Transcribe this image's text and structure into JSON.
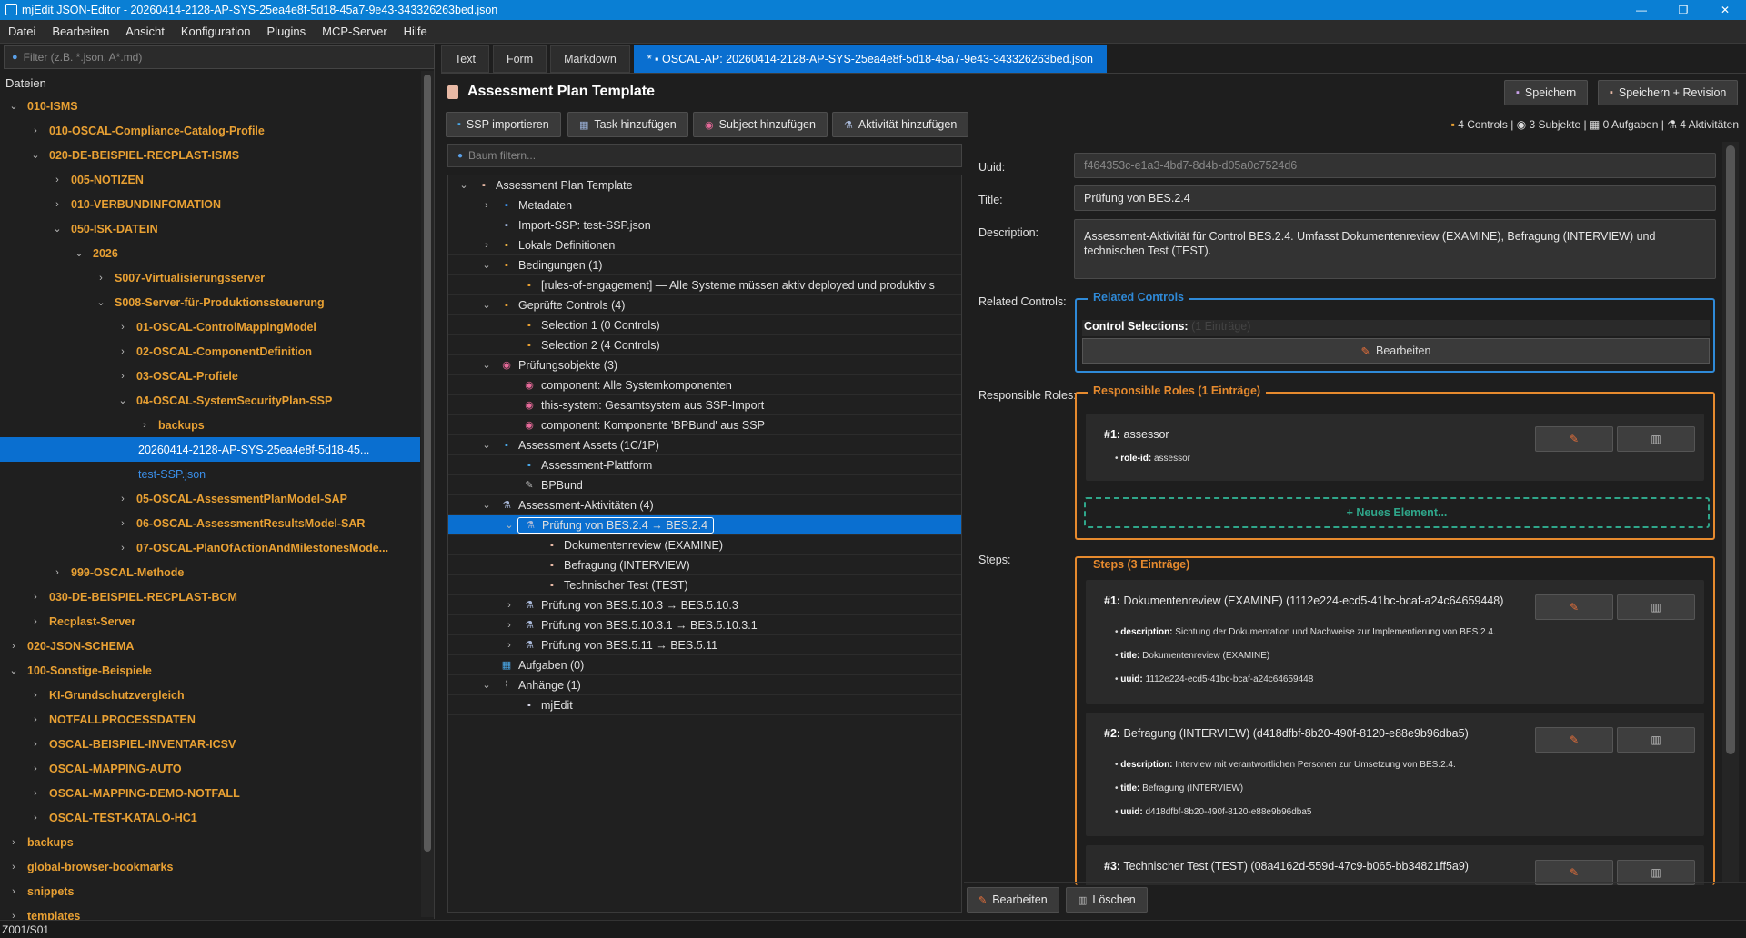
{
  "window": {
    "title": "mjEdit JSON-Editor - 20260414-2128-AP-SYS-25ea4e8f-5d18-45a7-9e43-343326263bed.json",
    "minimize": "—",
    "maximize": "❐",
    "close": "✕"
  },
  "menu": [
    "Datei",
    "Bearbeiten",
    "Ansicht",
    "Konfiguration",
    "Plugins",
    "MCP-Server",
    "Hilfe"
  ],
  "sidebar": {
    "filter_placeholder": "Filter (z.B. *.json, A*.md)",
    "header": "Dateien",
    "items": [
      {
        "label": "010-ISMS",
        "depth": 0,
        "open": true,
        "kind": "folder"
      },
      {
        "label": "010-OSCAL-Compliance-Catalog-Profile",
        "depth": 1,
        "open": false,
        "kind": "folder"
      },
      {
        "label": "020-DE-BEISPIEL-RECPLAST-ISMS",
        "depth": 1,
        "open": true,
        "kind": "folder"
      },
      {
        "label": "005-NOTIZEN",
        "depth": 2,
        "open": false,
        "kind": "folder"
      },
      {
        "label": "010-VERBUNDINFOMATION",
        "depth": 2,
        "open": false,
        "kind": "folder"
      },
      {
        "label": "050-ISK-DATEIN",
        "depth": 2,
        "open": true,
        "kind": "folder"
      },
      {
        "label": "2026",
        "depth": 3,
        "open": true,
        "kind": "folder"
      },
      {
        "label": "S007-Virtualisierungsserver",
        "depth": 4,
        "open": false,
        "kind": "folder"
      },
      {
        "label": "S008-Server-für-Produktionssteuerung",
        "depth": 4,
        "open": true,
        "kind": "folder"
      },
      {
        "label": "01-OSCAL-ControlMappingModel",
        "depth": 5,
        "open": false,
        "kind": "folder"
      },
      {
        "label": "02-OSCAL-ComponentDefinition",
        "depth": 5,
        "open": false,
        "kind": "folder"
      },
      {
        "label": "03-OSCAL-Profiele",
        "depth": 5,
        "open": false,
        "kind": "folder"
      },
      {
        "label": "04-OSCAL-SystemSecurityPlan-SSP",
        "depth": 5,
        "open": true,
        "kind": "folder"
      },
      {
        "label": "backups",
        "depth": 6,
        "open": false,
        "kind": "folder"
      },
      {
        "label": "20260414-2128-AP-SYS-25ea4e8f-5d18-45...",
        "depth": 6,
        "kind": "selected"
      },
      {
        "label": "test-SSP.json",
        "depth": 6,
        "kind": "blue"
      },
      {
        "label": "05-OSCAL-AssessmentPlanModel-SAP",
        "depth": 5,
        "open": false,
        "kind": "folder"
      },
      {
        "label": "06-OSCAL-AssessmentResultsModel-SAR",
        "depth": 5,
        "open": false,
        "kind": "folder"
      },
      {
        "label": "07-OSCAL-PlanOfActionAndMilestonesMode...",
        "depth": 5,
        "open": false,
        "kind": "folder"
      },
      {
        "label": "999-OSCAL-Methode",
        "depth": 2,
        "open": false,
        "kind": "folder"
      },
      {
        "label": "030-DE-BEISPIEL-RECPLAST-BCM",
        "depth": 1,
        "open": false,
        "kind": "folder"
      },
      {
        "label": "Recplast-Server",
        "depth": 1,
        "open": false,
        "kind": "folder"
      },
      {
        "label": "020-JSON-SCHEMA",
        "depth": 0,
        "open": false,
        "kind": "folder"
      },
      {
        "label": "100-Sonstige-Beispiele",
        "depth": 0,
        "open": true,
        "kind": "folder"
      },
      {
        "label": "KI-Grundschutzvergleich",
        "depth": 1,
        "open": false,
        "kind": "folder"
      },
      {
        "label": "NOTFALLPROCESSDATEN",
        "depth": 1,
        "open": false,
        "kind": "folder"
      },
      {
        "label": "OSCAL-BEISPIEL-INVENTAR-ICSV",
        "depth": 1,
        "open": false,
        "kind": "folder"
      },
      {
        "label": "OSCAL-MAPPING-AUTO",
        "depth": 1,
        "open": false,
        "kind": "folder"
      },
      {
        "label": "OSCAL-MAPPING-DEMO-NOTFALL",
        "depth": 1,
        "open": false,
        "kind": "folder"
      },
      {
        "label": "OSCAL-TEST-KATALO-HC1",
        "depth": 1,
        "open": false,
        "kind": "folder"
      },
      {
        "label": "backups",
        "depth": 0,
        "open": false,
        "kind": "folder"
      },
      {
        "label": "global-browser-bookmarks",
        "depth": 0,
        "open": false,
        "kind": "folder"
      },
      {
        "label": "snippets",
        "depth": 0,
        "open": false,
        "kind": "folder"
      },
      {
        "label": "templates",
        "depth": 0,
        "open": false,
        "kind": "folder"
      }
    ]
  },
  "tabs": [
    {
      "label": "Text"
    },
    {
      "label": "Form"
    },
    {
      "label": "Markdown"
    },
    {
      "label": "*  ▪  OSCAL-AP: 20260414-2128-AP-SYS-25ea4e8f-5d18-45a7-9e43-343326263bed.json",
      "active": true
    }
  ],
  "header": {
    "title": "Assessment Plan Template",
    "save": "Speichern",
    "save_rev": "Speichern + Revision"
  },
  "toolbar": {
    "import_ssp": "SSP importieren",
    "add_task": "Task hinzufügen",
    "add_subject": "Subject hinzufügen",
    "add_activity": "Aktivität hinzufügen"
  },
  "stats": "4 Controls |  ◉ 3 Subjekte |  ▦ 0 Aufgaben |  ⚗ 4 Aktivitäten",
  "tree": {
    "filter_placeholder": "Baum filtern...",
    "rows": [
      {
        "label": "Assessment Plan Template",
        "depth": 0,
        "chev": "⌄",
        "icon": "doc",
        "color": "#e8b9a5"
      },
      {
        "label": "Metadaten",
        "depth": 1,
        "chev": "›",
        "icon": "i",
        "color": "#3a8ee8"
      },
      {
        "label": "Import-SSP: test-SSP.json",
        "depth": 1,
        "chev": "",
        "icon": "imp",
        "color": "#9ab0d8"
      },
      {
        "label": "Lokale Definitionen",
        "depth": 1,
        "chev": "›",
        "icon": "fold",
        "color": "#e8b040"
      },
      {
        "label": "Bedingungen (1)",
        "depth": 1,
        "chev": "⌄",
        "icon": "clip",
        "color": "#e8a033"
      },
      {
        "label": "[rules-of-engagement] — Alle Systeme müssen aktiv deployed und produktiv s",
        "depth": 2,
        "chev": "",
        "icon": "clip",
        "color": "#e8a033"
      },
      {
        "label": "Geprüfte Controls (4)",
        "depth": 1,
        "chev": "⌄",
        "icon": "lock",
        "color": "#e8a033"
      },
      {
        "label": "Selection 1 (0 Controls)",
        "depth": 2,
        "chev": "",
        "icon": "lock",
        "color": "#e8a033"
      },
      {
        "label": "Selection 2 (4 Controls)",
        "depth": 2,
        "chev": "",
        "icon": "lock",
        "color": "#e8a033"
      },
      {
        "label": "Prüfungsobjekte (3)",
        "depth": 1,
        "chev": "⌄",
        "icon": "tgt",
        "color": "#e86a9a"
      },
      {
        "label": "component: Alle Systemkomponenten",
        "depth": 2,
        "chev": "",
        "icon": "tgt",
        "color": "#e86a9a"
      },
      {
        "label": "this-system: Gesamtsystem aus SSP-Import",
        "depth": 2,
        "chev": "",
        "icon": "tgt",
        "color": "#e86a9a"
      },
      {
        "label": "component: Komponente 'BPBund' aus SSP",
        "depth": 2,
        "chev": "",
        "icon": "tgt",
        "color": "#e86a9a"
      },
      {
        "label": "Assessment Assets (1C/1P)",
        "depth": 1,
        "chev": "⌄",
        "icon": "pc",
        "color": "#4aa8e8"
      },
      {
        "label": "Assessment-Plattform",
        "depth": 2,
        "chev": "",
        "icon": "pc",
        "color": "#4aa8e8"
      },
      {
        "label": "BPBund",
        "depth": 2,
        "chev": "",
        "icon": "tool",
        "color": "#bbb"
      },
      {
        "label": "Assessment-Aktivitäten (4)",
        "depth": 1,
        "chev": "⌄",
        "icon": "flask",
        "color": "#a8b8d8"
      },
      {
        "label": "Prüfung von BES.2.4 → BES.2.4",
        "depth": 2,
        "chev": "⌄",
        "icon": "flask",
        "color": "#a8b8d8",
        "selected": true
      },
      {
        "label": "Dokumentenreview (EXAMINE)",
        "depth": 3,
        "chev": "",
        "icon": "note",
        "color": "#e8b9a5"
      },
      {
        "label": "Befragung (INTERVIEW)",
        "depth": 3,
        "chev": "",
        "icon": "note",
        "color": "#e8b9a5"
      },
      {
        "label": "Technischer Test (TEST)",
        "depth": 3,
        "chev": "",
        "icon": "note",
        "color": "#e8b9a5"
      },
      {
        "label": "Prüfung von BES.5.10.3 → BES.5.10.3",
        "depth": 2,
        "chev": "›",
        "icon": "flask",
        "color": "#a8b8d8"
      },
      {
        "label": "Prüfung von BES.5.10.3.1 → BES.5.10.3.1",
        "depth": 2,
        "chev": "›",
        "icon": "flask",
        "color": "#a8b8d8"
      },
      {
        "label": "Prüfung von BES.5.11 → BES.5.11",
        "depth": 2,
        "chev": "›",
        "icon": "flask",
        "color": "#a8b8d8"
      },
      {
        "label": "Aufgaben (0)",
        "depth": 1,
        "chev": "",
        "icon": "cal",
        "color": "#4aa8e8"
      },
      {
        "label": "Anhänge (1)",
        "depth": 1,
        "chev": "⌄",
        "icon": "clipx",
        "color": "#999"
      },
      {
        "label": "mjEdit",
        "depth": 2,
        "chev": "",
        "icon": "book",
        "color": "#d8d8e8"
      }
    ]
  },
  "detail": {
    "uuid_label": "Uuid:",
    "uuid": "f464353c-e1a3-4bd7-8d4b-d05a0c7524d6",
    "title_label": "Title:",
    "title": "Prüfung von BES.2.4",
    "desc_label": "Description:",
    "desc": "Assessment-Aktivität für Control BES.2.4. Umfasst Dokumentenreview (EXAMINE), Befragung (INTERVIEW) und technischen Test (TEST).",
    "related_label": "Related Controls:",
    "related_legend": "Related Controls",
    "control_sel": "Control Selections:",
    "control_sel_val": "(1 Einträge)",
    "edit": "Bearbeiten",
    "roles_label": "Responsible Roles:",
    "roles_legend": "Responsible Roles (1 Einträge)",
    "role_head_num": "#1:",
    "role_head": " assessor",
    "role_line_k": "role-id:",
    "role_line_v": " assessor",
    "new_el": "+ Neues Element...",
    "steps_label": "Steps:",
    "steps_legend": "Steps (3 Einträge)",
    "steps": [
      {
        "num": "#1:",
        "head": " Dokumentenreview (EXAMINE) (1112e224-ecd5-41bc-bcaf-a24c64659448)",
        "d": "Sichtung der Dokumentation und Nachweise zur Implementierung von BES.2.4.",
        "t": "Dokumentenreview (EXAMINE)",
        "u": "1112e224-ecd5-41bc-bcaf-a24c64659448"
      },
      {
        "num": "#2:",
        "head": " Befragung (INTERVIEW) (d418dfbf-8b20-490f-8120-e88e9b96dba5)",
        "d": "Interview mit verantwortlichen Personen zur Umsetzung von BES.2.4.",
        "t": "Befragung (INTERVIEW)",
        "u": "d418dfbf-8b20-490f-8120-e88e9b96dba5"
      },
      {
        "num": "#3:",
        "head": " Technischer Test (TEST) (08a4162d-559d-47c9-b065-bb34821ff5a9)"
      }
    ],
    "k_desc": "description:",
    "k_title": "title:",
    "k_uuid": "uuid:",
    "bottom_edit": "Bearbeiten",
    "bottom_del": "Löschen"
  },
  "status": "Z001/S01"
}
